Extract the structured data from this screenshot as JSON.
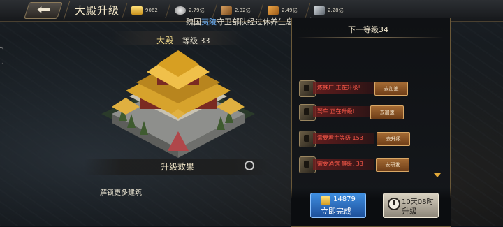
{
  "header": {
    "title": "大殿升级",
    "resources": [
      {
        "icon": "gold-ingot-icon",
        "value": "9062",
        "color": "#e2b23c"
      },
      {
        "icon": "silver-icon",
        "value": "2.79亿",
        "color": "#c9c9c9"
      },
      {
        "icon": "wood-icon",
        "value": "2.32亿",
        "color": "#b07a3a"
      },
      {
        "icon": "food-icon",
        "value": "2.49亿",
        "color": "#c8822c"
      },
      {
        "icon": "iron-icon",
        "value": "2.28亿",
        "color": "#9aa3ad"
      }
    ]
  },
  "notice": {
    "prefix": "魏国",
    "highlight": "夷陵",
    "suffix": "守卫部队经过休养生息，已经"
  },
  "building": {
    "name": "大殿",
    "level": "等级 33"
  },
  "effect": {
    "title": "升级效果",
    "items": [
      "解锁更多建筑"
    ]
  },
  "panel": {
    "title": "下一等级34",
    "requirements": [
      {
        "text": "炼铁厂 正在升级!",
        "action": "去加速"
      },
      {
        "text": "驽车 正在升级!",
        "action": "去加速"
      },
      {
        "text": "需要君主等级 153",
        "action": "去升级"
      },
      {
        "text": "需要酒馆 等级: 33",
        "action": "去研发"
      }
    ]
  },
  "buttons": {
    "finish_cost": "14879",
    "finish_label": "立即完成",
    "upgrade_time": "10天08时",
    "upgrade_label": "升级"
  },
  "colors": {
    "accent_gold": "#e2b23c",
    "warning_red": "#ff5a4a",
    "highlight_blue": "#6fb6ff"
  }
}
